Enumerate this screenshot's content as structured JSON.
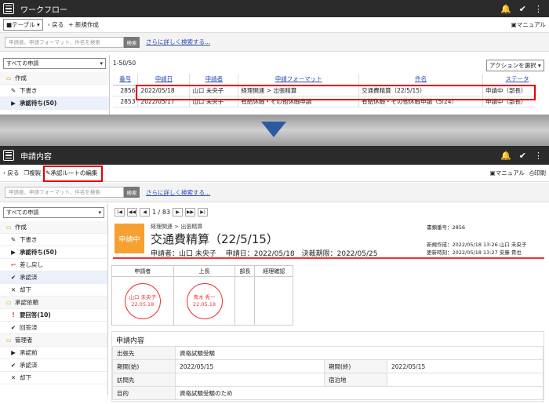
{
  "top": {
    "title": "ワークフロー",
    "view_select": "テーブル",
    "back": "戻る",
    "new": "新規作成",
    "manual": "マニュアル",
    "search_placeholder": "申請者、申請フォーマット、件名を検索",
    "search_button": "検索",
    "advanced": "さらに詳しく検索する...",
    "filter": "すべての申請",
    "sidebar": [
      {
        "label": "作成"
      },
      {
        "label": "下書き"
      },
      {
        "label": "承認待ち(50)"
      }
    ],
    "count": "1-50/50",
    "action": "アクションを選択",
    "columns": [
      "番号",
      "申請日",
      "申請者",
      "申請フォーマット",
      "件名",
      "ステータ"
    ],
    "rows": [
      [
        "2856",
        "2022/05/18",
        "山口 未央子",
        "経理関連 > 出張精算",
        "交通費精算（22/5/15）",
        "申請中（部長）"
      ],
      [
        "2853",
        "2022/05/17",
        "山口 未央子",
        "有給休暇・その他休暇申請",
        "有給休暇・その他休暇申請（5/24）",
        "申請中（部長）"
      ]
    ]
  },
  "bottom": {
    "title": "申請内容",
    "back": "戻る",
    "copy": "複製",
    "edit_route": "承認ルートの編集",
    "manual": "マニュアル",
    "print": "印刷",
    "search_placeholder": "申請者、申請フォーマット、件名を検索",
    "search_button": "検索",
    "advanced": "さらに詳しく検索する...",
    "filter": "すべての申請",
    "sidebar": [
      {
        "label": "作成"
      },
      {
        "label": "下書き"
      },
      {
        "label": "承認待ち(50)"
      },
      {
        "label": "差し戻し"
      },
      {
        "label": "承認済"
      },
      {
        "label": "却下"
      },
      {
        "label": "承認依頼"
      },
      {
        "label": "要回答(10)"
      },
      {
        "label": "回答済"
      },
      {
        "label": "管理者"
      },
      {
        "label": "承認前"
      },
      {
        "label": "承認済"
      },
      {
        "label": "却下"
      }
    ],
    "pager": "1 / 83",
    "category": "経理関連 > 出張精算",
    "status_badge": "申請中",
    "subject": "交通費精算（22/5/15）",
    "meta_line": "申請者：山口 未央子　 申請日：2022/05/18　決裁期限：2022/05/25",
    "doc_no": "書類番号：2856",
    "created": "新規作成：2022/05/18 13:26 山口 未央子",
    "updated": "更新時刻：2022/05/18 13:27 安藤 貴也",
    "approval_cols": [
      "申請者",
      "上長",
      "部長",
      "経理確認"
    ],
    "stamps": [
      {
        "name": "山口 未央子",
        "date": "22.05.18"
      },
      {
        "name": "青木 秀一",
        "date": "22.05.18"
      }
    ],
    "details_title": "申請内容",
    "details": {
      "dest_label": "出張先",
      "dest": "資格試験受験",
      "from_label": "期間(始)",
      "from": "2022/05/15",
      "to_label": "期間(終)",
      "to": "2022/05/15",
      "visit_label": "訪問先",
      "visit": "",
      "stay_label": "宿泊地",
      "stay": "",
      "purpose_label": "目的",
      "purpose": "資格試験受験のため"
    }
  },
  "colors": {
    "accent_red": "#e30000",
    "arrow_blue": "#2b5aa0",
    "badge_orange": "#f5a030"
  }
}
